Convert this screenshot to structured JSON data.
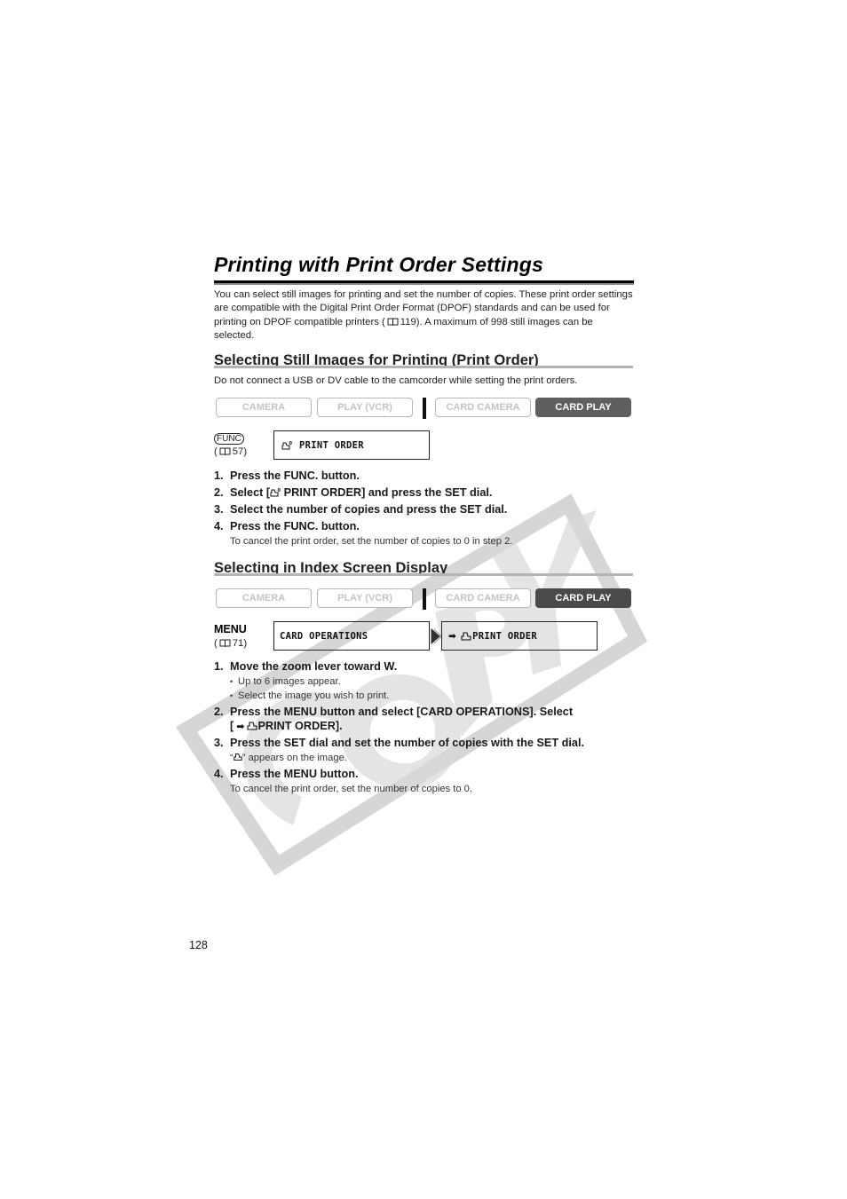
{
  "page": {
    "title": "Printing with Print Order Settings",
    "intro_before_ref": "You can select still images for printing and set the number of copies. These print order settings are compatible with the Digital Print Order Format (DPOF) standards and can be used for printing on DPOF compatible printers (",
    "intro_ref": "119",
    "intro_after_ref": "). A maximum of 998 still images can be selected.",
    "page_number": "128",
    "watermark": "COPY"
  },
  "section1": {
    "heading": "Selecting Still Images for Printing (Print Order)",
    "note": "Do not connect a USB or DV cable to the camcorder while setting the print orders.",
    "modes": [
      {
        "label": "CAMERA",
        "active": false
      },
      {
        "label": "PLAY (VCR)",
        "active": false
      },
      {
        "label": "CARD CAMERA",
        "active": false
      },
      {
        "label": "CARD PLAY",
        "active": true
      }
    ],
    "access_button": "FUNC",
    "access_ref": "57",
    "lcd_icon": "print-order-icon",
    "lcd_text": "PRINT ORDER",
    "steps": [
      {
        "num": "1.",
        "text": "Press the FUNC. button."
      },
      {
        "num": "2.",
        "text_before": "Select [",
        "icon": "print-order-icon",
        "text_after": " PRINT ORDER] and press the SET dial."
      },
      {
        "num": "3.",
        "text": "Select the number of copies and press the SET dial."
      },
      {
        "num": "4.",
        "text": "Press the FUNC. button.",
        "sub": "To cancel the print order, set the number of copies to 0 in step 2."
      }
    ]
  },
  "section2": {
    "heading": "Selecting in Index Screen Display",
    "modes": [
      {
        "label": "CAMERA",
        "active": false
      },
      {
        "label": "PLAY (VCR)",
        "active": false
      },
      {
        "label": "CARD CAMERA",
        "active": false
      },
      {
        "label": "CARD PLAY",
        "active": true
      }
    ],
    "access_button": "MENU",
    "access_ref": "71",
    "lcd1_text": "CARD OPERATIONS",
    "lcd2_arrow": "➡",
    "lcd2_text": "PRINT ORDER",
    "steps": [
      {
        "num": "1.",
        "text": "Move the zoom lever toward W.",
        "bullets": [
          "Up to 6 images appear.",
          "Select the image you wish to print."
        ]
      },
      {
        "num": "2.",
        "text_line1": "Press the MENU button and select [CARD OPERATIONS]. Select",
        "text_line2_before": "[",
        "arrow": "➡",
        "text_line2_after": "PRINT ORDER]."
      },
      {
        "num": "3.",
        "text": "Press the SET dial and set the number of copies with the SET dial.",
        "sub_before": "“",
        "sub_after": "” appears on the image."
      },
      {
        "num": "4.",
        "text": "Press the MENU button.",
        "sub": "To cancel the print order, set the number of copies to 0."
      }
    ]
  }
}
